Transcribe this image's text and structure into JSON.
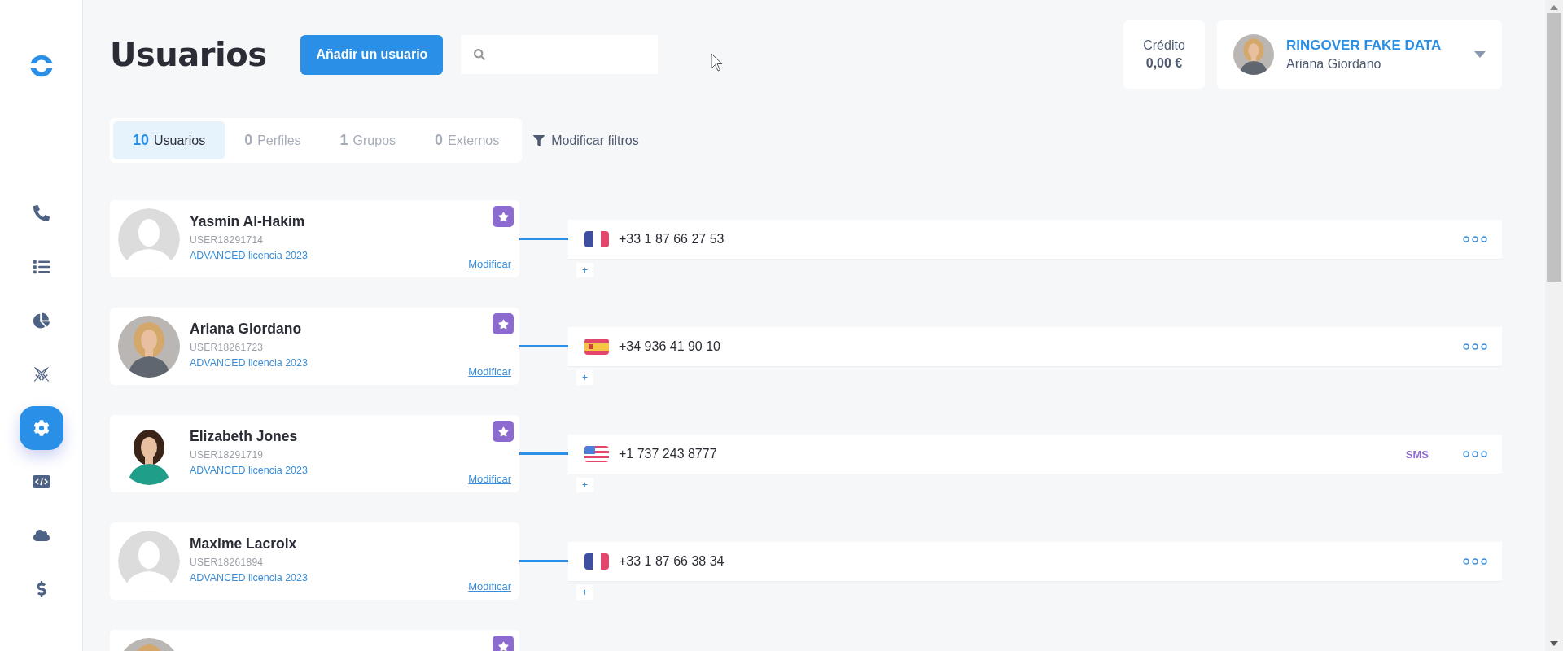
{
  "sidebar": {
    "items": [
      {
        "kind": "phone",
        "selected": false
      },
      {
        "kind": "list",
        "selected": false
      },
      {
        "kind": "chart",
        "selected": false
      },
      {
        "kind": "swords",
        "selected": false
      },
      {
        "kind": "settings",
        "selected": true
      },
      {
        "kind": "code",
        "selected": false
      },
      {
        "kind": "cloud",
        "selected": false
      },
      {
        "kind": "dollar",
        "selected": false
      }
    ]
  },
  "header": {
    "title": "Usuarios",
    "add_button": "Añadir un usuario",
    "credit": {
      "label": "Crédito",
      "value": "0,00 €"
    },
    "account": {
      "company": "RINGOVER FAKE DATA",
      "user": "Ariana Giordano"
    }
  },
  "tabs": [
    {
      "count": "10",
      "label": "Usuarios",
      "selected": true
    },
    {
      "count": "0",
      "label": "Perfiles",
      "selected": false
    },
    {
      "count": "1",
      "label": "Grupos",
      "selected": false
    },
    {
      "count": "0",
      "label": "Externos",
      "selected": false
    }
  ],
  "filter_button": "Modificar filtros",
  "users": [
    {
      "name": "Yasmin Al-Hakim",
      "user_id": "USER18291714",
      "license": "ADVANCED licencia 2023",
      "edit": "Modificar",
      "starred": true,
      "avatar": {
        "kind": "silhouette"
      },
      "phone": {
        "flag": {
          "kind": "fr"
        },
        "number": "+33 1 87 66 27 53"
      },
      "add": "+"
    },
    {
      "name": "Ariana Giordano",
      "user_id": "USER18261723",
      "license": "ADVANCED licencia 2023",
      "edit": "Modificar",
      "starred": true,
      "phone": {
        "flag": {
          "kind": "es"
        },
        "number": "+34 936 41 90 10"
      },
      "add": "+"
    },
    {
      "name": "Elizabeth Jones",
      "user_id": "USER18291719",
      "license": "ADVANCED licencia 2023",
      "edit": "Modificar",
      "starred": true,
      "phone": {
        "flag": {
          "kind": "us"
        },
        "number": "+1 737 243 8777",
        "badge": "SMS"
      },
      "add": "+"
    },
    {
      "name": "Maxime Lacroix",
      "user_id": "USER18261894",
      "license": "ADVANCED licencia 2023",
      "edit": "Modificar",
      "starred": false,
      "avatar": {
        "kind": "silhouette"
      },
      "phone": {
        "flag": {
          "kind": "fr"
        },
        "number": "+33 1 87 66 38 34"
      },
      "add": "+"
    },
    {
      "starred": true
    }
  ]
}
